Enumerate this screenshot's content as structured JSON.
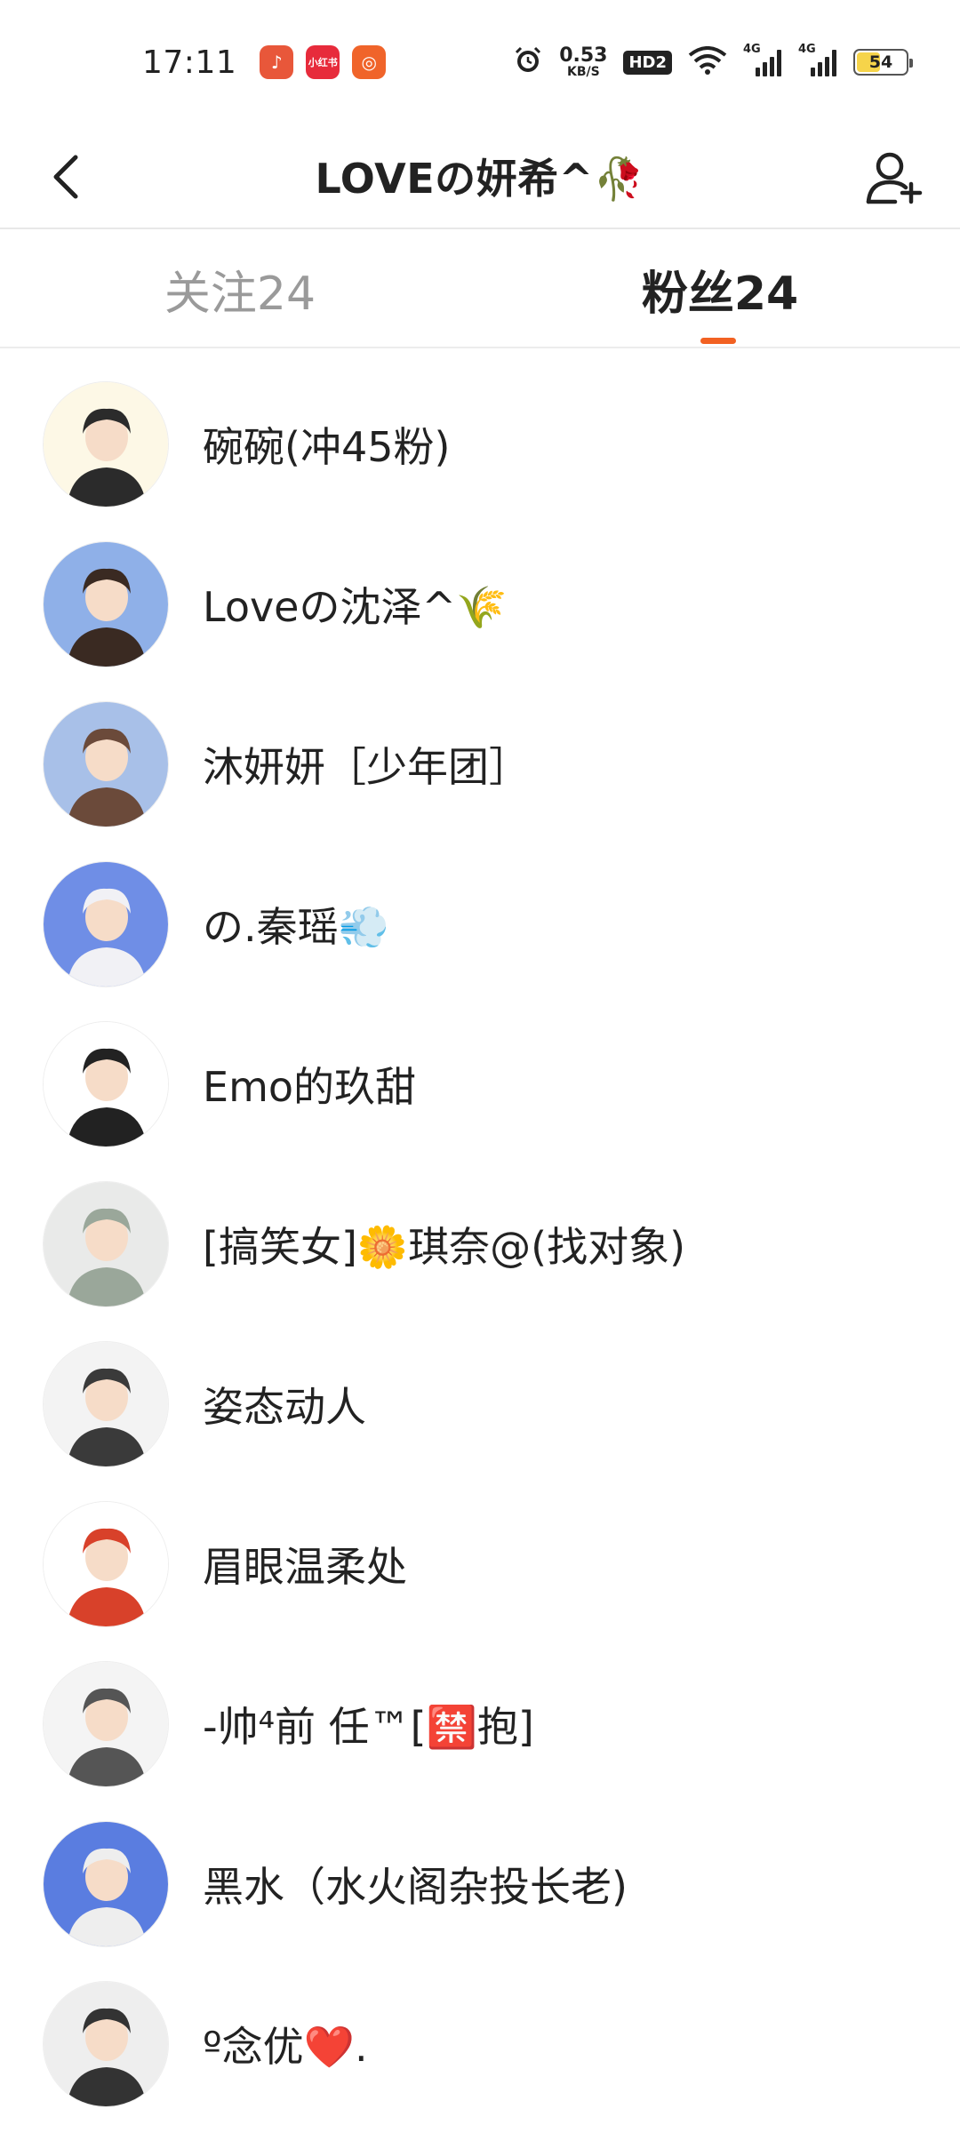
{
  "status_bar": {
    "time": "17:11",
    "apps": [
      {
        "icon": "music-app-icon",
        "color": "#e8573a",
        "glyph": "♪"
      },
      {
        "icon": "xiaohongshu-app-icon",
        "color": "#e72b3b",
        "glyph": "小红书"
      },
      {
        "icon": "camera-app-icon",
        "color": "#f0642a",
        "glyph": "◎"
      }
    ],
    "speed_value": "0.53",
    "speed_unit": "KB/S",
    "hd_label": "HD2",
    "net1_label": "4G",
    "net2_label": "4G",
    "battery": "54"
  },
  "header": {
    "title": "LOVEの妍希^🥀"
  },
  "tabs": [
    {
      "label": "关注24",
      "active": false
    },
    {
      "label": "粉丝24",
      "active": true
    }
  ],
  "followers": [
    {
      "name": "碗碗(冲45粉)",
      "avatar_bg": "#fdf8e6",
      "avatar_fg": "#2b2b2b"
    },
    {
      "name": "Loveの沈泽^🌾",
      "avatar_bg": "#8fb0e8",
      "avatar_fg": "#3a2a22"
    },
    {
      "name": "沐妍妍［少年团］",
      "avatar_bg": "#a8c0e8",
      "avatar_fg": "#6b4a3a"
    },
    {
      "name": "の.秦瑶💨",
      "avatar_bg": "#6f8ee6",
      "avatar_fg": "#f1f1f5"
    },
    {
      "name": "Emo的玖甜",
      "avatar_bg": "#ffffff",
      "avatar_fg": "#222222"
    },
    {
      "name": "[搞笑女]🌼琪奈@(找对象)",
      "avatar_bg": "#e9eae9",
      "avatar_fg": "#9aa79a"
    },
    {
      "name": "姿态动人",
      "avatar_bg": "#f3f3f3",
      "avatar_fg": "#3a3a3a"
    },
    {
      "name": "眉眼温柔处",
      "avatar_bg": "#ffffff",
      "avatar_fg": "#d8412a"
    },
    {
      "name": "-帅⁴前 任™[🈲抱]",
      "avatar_bg": "#f4f4f4",
      "avatar_fg": "#555555"
    },
    {
      "name": "黑水（水火阁杂投长老)",
      "avatar_bg": "#5a7de0",
      "avatar_fg": "#eeeeee"
    },
    {
      "name": "º念优❤️.",
      "avatar_bg": "#eeeeee",
      "avatar_fg": "#333333"
    }
  ],
  "colors": {
    "accent": "#f26122",
    "tab_inactive": "#9a9a9a",
    "text": "#222222"
  }
}
